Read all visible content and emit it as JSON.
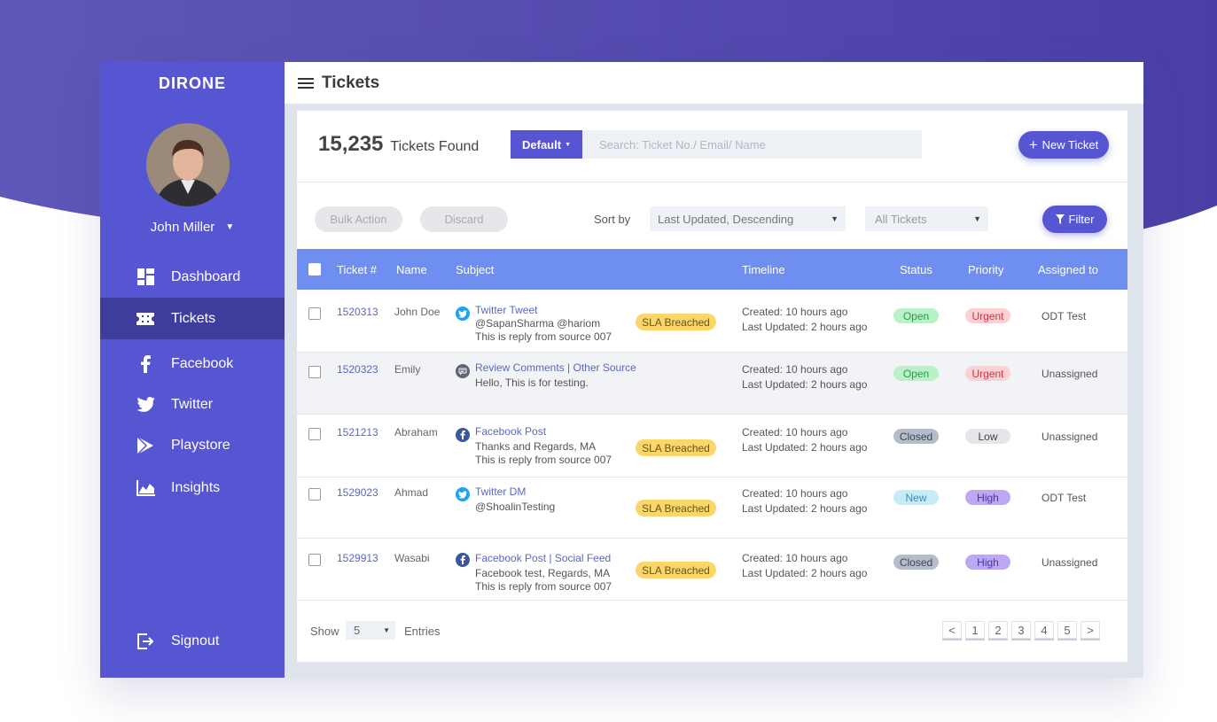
{
  "app": {
    "brand": "DIRONE",
    "page_title": "Tickets"
  },
  "user": {
    "name": "John Miller"
  },
  "sidebar": {
    "items": [
      {
        "label": "Dashboard",
        "icon": "dashboard-icon"
      },
      {
        "label": "Tickets",
        "icon": "ticket-icon",
        "active": true
      },
      {
        "label": "Facebook",
        "icon": "facebook-icon"
      },
      {
        "label": "Twitter",
        "icon": "twitter-icon"
      },
      {
        "label": "Playstore",
        "icon": "playstore-icon"
      },
      {
        "label": "Insights",
        "icon": "insights-icon"
      }
    ],
    "signout": "Signout"
  },
  "summary": {
    "count": "15,235",
    "label": "Tickets Found"
  },
  "toolbar": {
    "default_label": "Default",
    "search_placeholder": "Search: Ticket No./ Email/ Name",
    "new_ticket_label": "New Ticket",
    "bulk_action_label": "Bulk Action",
    "discard_label": "Discard",
    "sort_by_label": "Sort by",
    "sort_value": "Last Updated, Descending",
    "ticket_scope": "All Tickets",
    "filter_label": "Filter"
  },
  "table": {
    "headers": {
      "ticket": "Ticket #",
      "name": "Name",
      "subject": "Subject",
      "timeline": "Timeline",
      "status": "Status",
      "priority": "Priority",
      "assigned": "Assigned to"
    },
    "rows": [
      {
        "id": "1520313",
        "name": "John Doe",
        "source": "twitter-icon",
        "subject_title": "Twitter Tweet",
        "subject_line1": "@SapanSharma @hariom",
        "subject_line2": "This is reply from source 007",
        "sla": "SLA Breached",
        "created": "Created: 10 hours ago",
        "updated": "Last Updated: 2 hours ago",
        "status": "Open",
        "priority": "Urgent",
        "assigned": "ODT Test"
      },
      {
        "id": "1520323",
        "name": "Emily",
        "source": "comment-icon",
        "subject_title": "Review Comments | Other Source",
        "subject_line1": "Hello, This is for testing.",
        "subject_line2": "",
        "sla": "",
        "created": "Created: 10 hours ago",
        "updated": "Last Updated: 2 hours ago",
        "status": "Open",
        "priority": "Urgent",
        "assigned": "Unassigned"
      },
      {
        "id": "1521213",
        "name": "Abraham",
        "source": "facebook-icon",
        "subject_title": "Facebook Post",
        "subject_line1": "Thanks and Regards, MA",
        "subject_line2": "This is reply from source 007",
        "sla": "SLA Breached",
        "created": "Created: 10 hours ago",
        "updated": "Last Updated: 2 hours ago",
        "status": "Closed",
        "priority": "Low",
        "assigned": "Unassigned"
      },
      {
        "id": "1529023",
        "name": "Ahmad",
        "source": "twitter-icon",
        "subject_title": "Twitter DM",
        "subject_line1": "@ShoalinTesting",
        "subject_line2": "",
        "sla": "SLA Breached",
        "created": "Created: 10 hours ago",
        "updated": "Last Updated: 2 hours ago",
        "status": "New",
        "priority": "High",
        "assigned": "ODT Test"
      },
      {
        "id": "1529913",
        "name": "Wasabi",
        "source": "facebook-icon",
        "subject_title": "Facebook Post | Social Feed",
        "subject_line1": "Facebook test, Regards, MA",
        "subject_line2": "This is reply from source 007",
        "sla": "SLA Breached",
        "created": "Created: 10 hours ago",
        "updated": "Last Updated: 2 hours ago",
        "status": "Closed",
        "priority": "High",
        "assigned": "Unassigned"
      }
    ]
  },
  "pagination": {
    "show_label": "Show",
    "entries_value": "5",
    "entries_label": "Entries",
    "prev": "<",
    "pages": [
      "1",
      "2",
      "3",
      "4",
      "5"
    ],
    "next": ">"
  },
  "colors": {
    "accent": "#5655d2",
    "header_row": "#6f8ff0",
    "sla": "#fbd66a"
  }
}
